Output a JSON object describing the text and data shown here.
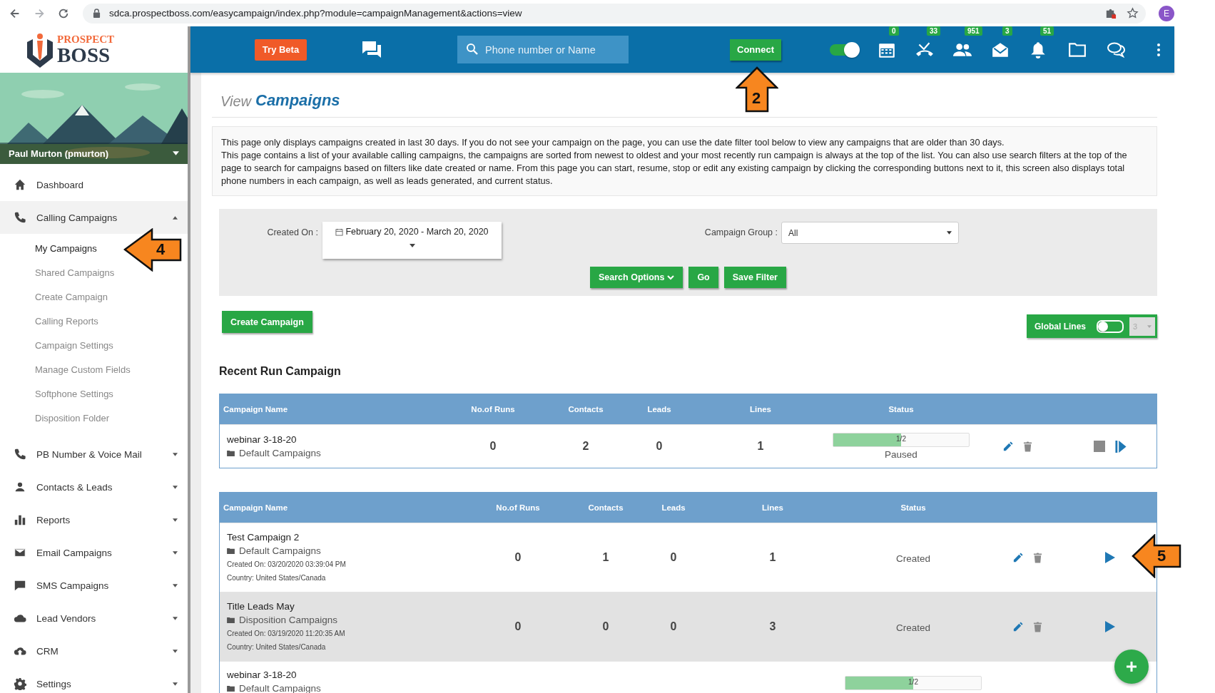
{
  "browser": {
    "url": "sdca.prospectboss.com/easycampaign/index.php?module=campaignManagement&actions=view",
    "profile_initial": "E"
  },
  "logo": {
    "top": "PROSPECT",
    "bottom": "BOSS"
  },
  "header": {
    "try_beta": "Try Beta",
    "search_placeholder": "Phone number or Name",
    "connect": {
      "label": "Connect",
      "annotation": "2"
    },
    "toggle_on": true,
    "badges": [
      "0",
      "33",
      "951",
      "3",
      "51"
    ]
  },
  "sidebar": {
    "user": "Paul Murton (pmurton)",
    "items": [
      {
        "label": "Dashboard",
        "selected": false
      },
      {
        "label": "Calling Campaigns",
        "expanded": true,
        "selected": false,
        "children": [
          {
            "label": "My Campaigns",
            "selected": true,
            "annotation": "4"
          },
          {
            "label": "Shared Campaigns",
            "selected": false
          },
          {
            "label": "Create Campaign",
            "selected": false
          },
          {
            "label": "Calling Reports",
            "selected": false
          },
          {
            "label": "Campaign Settings",
            "selected": false
          },
          {
            "label": "Manage Custom Fields",
            "selected": false
          },
          {
            "label": "Softphone Settings",
            "selected": false
          },
          {
            "label": "Disposition Folder",
            "selected": false
          }
        ]
      },
      {
        "label": "PB Number & Voice Mail",
        "expanded": false,
        "selected": false
      },
      {
        "label": "Contacts & Leads",
        "expanded": false,
        "selected": false
      },
      {
        "label": "Reports",
        "expanded": false,
        "selected": false
      },
      {
        "label": "Email Campaigns",
        "expanded": false,
        "selected": false
      },
      {
        "label": "SMS Campaigns",
        "expanded": false,
        "selected": false
      },
      {
        "label": "Lead Vendors",
        "expanded": false,
        "selected": false
      },
      {
        "label": "CRM",
        "expanded": false,
        "selected": false
      },
      {
        "label": "Settings",
        "expanded": false,
        "selected": false
      }
    ]
  },
  "page_title": {
    "prefix": "View",
    "title": "Campaigns"
  },
  "description": [
    "This page only displays campaigns created in last 30 days. If you do not see your campaign on the page, you can use the date filter tool below to view any campaigns that are older than 30 days.",
    "This page contains a list of your available calling campaigns, the campaigns are sorted from newest to oldest and your most recently run campaign is always at the top of the list. You can also use search filters at the top of the page to search for campaigns based on filters like date created or name. From this page you can start, resume, stop or edit any existing campaign by clicking the corresponding buttons next to it, this screen also displays total phone numbers in each campaign, as well as leads generated, and current status."
  ],
  "filter": {
    "created_on_label": "Created On :",
    "date_range": "February 20, 2020 - March 20, 2020",
    "group_label": "Campaign Group :",
    "group_value": "All",
    "buttons": [
      "Search Options",
      "Go",
      "Save Filter"
    ]
  },
  "create_campaign": "Create Campaign",
  "global_lines": {
    "label": "Global Lines",
    "on": false,
    "value": "3",
    "disabled": true
  },
  "recent": {
    "heading": "Recent Run Campaign",
    "columns": [
      "Campaign Name",
      "No.of Runs",
      "Contacts",
      "Leads",
      "Lines",
      "Status"
    ],
    "rows": [
      {
        "name": "webinar 3-18-20",
        "folder": "Default Campaigns",
        "runs": "0",
        "contacts": "2",
        "leads": "0",
        "lines": "1",
        "progress": {
          "level": 0.5,
          "text": "1/2"
        },
        "status": "Paused",
        "selected": false,
        "kind": "running"
      }
    ]
  },
  "campaigns": {
    "columns": [
      "Campaign Name",
      "No.of Runs",
      "Contacts",
      "Leads",
      "Lines",
      "Status"
    ],
    "rows": [
      {
        "name": "Test Campaign 2",
        "folder": "Default Campaigns",
        "created_on": "Created On: 03/20/2020 03:39:04 PM",
        "country": "Country: United States/Canada",
        "runs": "0",
        "contacts": "1",
        "leads": "0",
        "lines": "1",
        "status": "Created",
        "selected": false,
        "kind": "idle",
        "annotation": "5"
      },
      {
        "name": "Title Leads May",
        "folder": "Disposition Campaigns",
        "created_on": "Created On: 03/19/2020 11:20:35 AM",
        "country": "Country: United States/Canada",
        "runs": "0",
        "contacts": "0",
        "leads": "0",
        "lines": "3",
        "status": "Created",
        "selected": true,
        "kind": "idle"
      },
      {
        "name": "webinar 3-18-20",
        "folder": "Default Campaigns",
        "progress": {
          "level": 0.5,
          "text": "1/2"
        },
        "selected": false
      }
    ]
  }
}
